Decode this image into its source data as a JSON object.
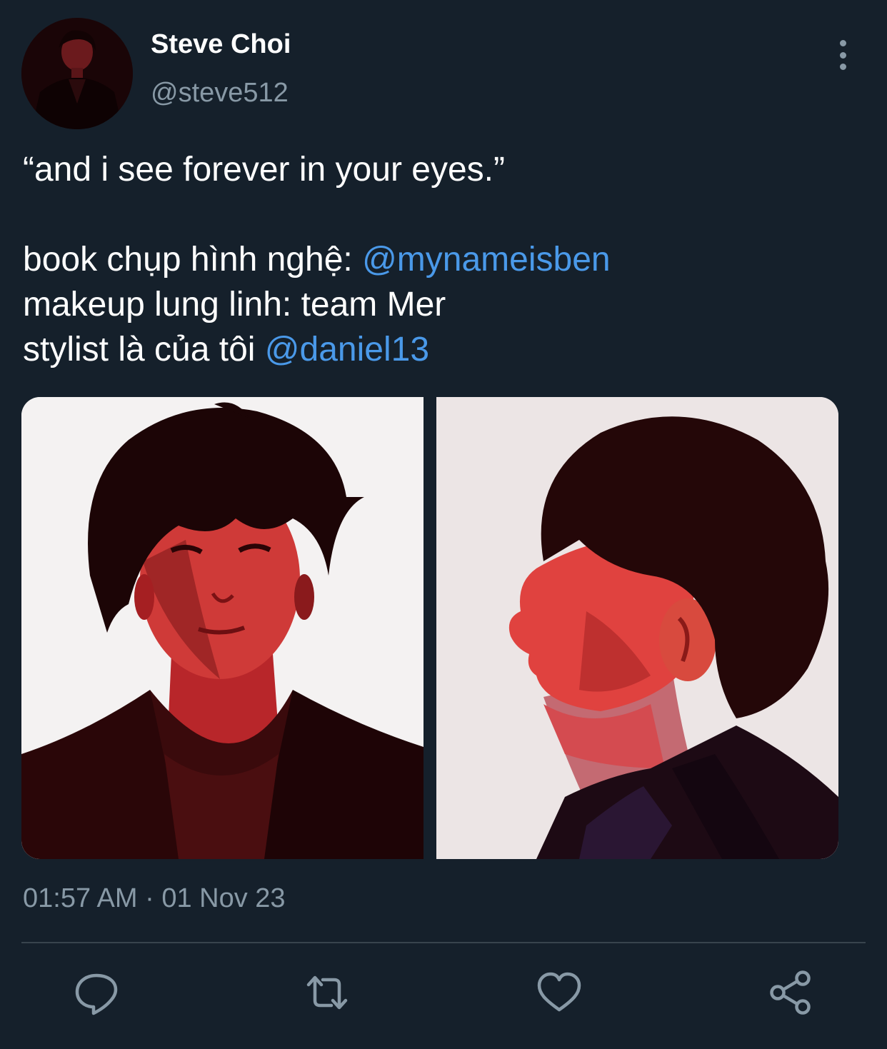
{
  "tweet": {
    "author": {
      "display_name": "Steve Choi",
      "handle": "@steve512"
    },
    "text_lines": [
      {
        "text": "“and i see forever in your eyes.”",
        "mention": ""
      },
      {
        "text": "book chụp hình nghệ: ",
        "mention": "@mynameisben"
      },
      {
        "text": "makeup lung linh: team Mer",
        "mention": ""
      },
      {
        "text": "stylist là của tôi ",
        "mention": "@daniel13"
      }
    ],
    "timestamp": "01:57 AM · 01 Nov 23"
  },
  "actions": [
    {
      "name": "reply",
      "icon": "reply-icon"
    },
    {
      "name": "retweet",
      "icon": "retweet-icon"
    },
    {
      "name": "like",
      "icon": "heart-icon"
    },
    {
      "name": "share",
      "icon": "share-icon"
    }
  ],
  "colors": {
    "background": "#15202b",
    "text": "#ffffff",
    "secondary_text": "#8899a6",
    "mention": "#4a99e9",
    "divider": "#38444d"
  }
}
